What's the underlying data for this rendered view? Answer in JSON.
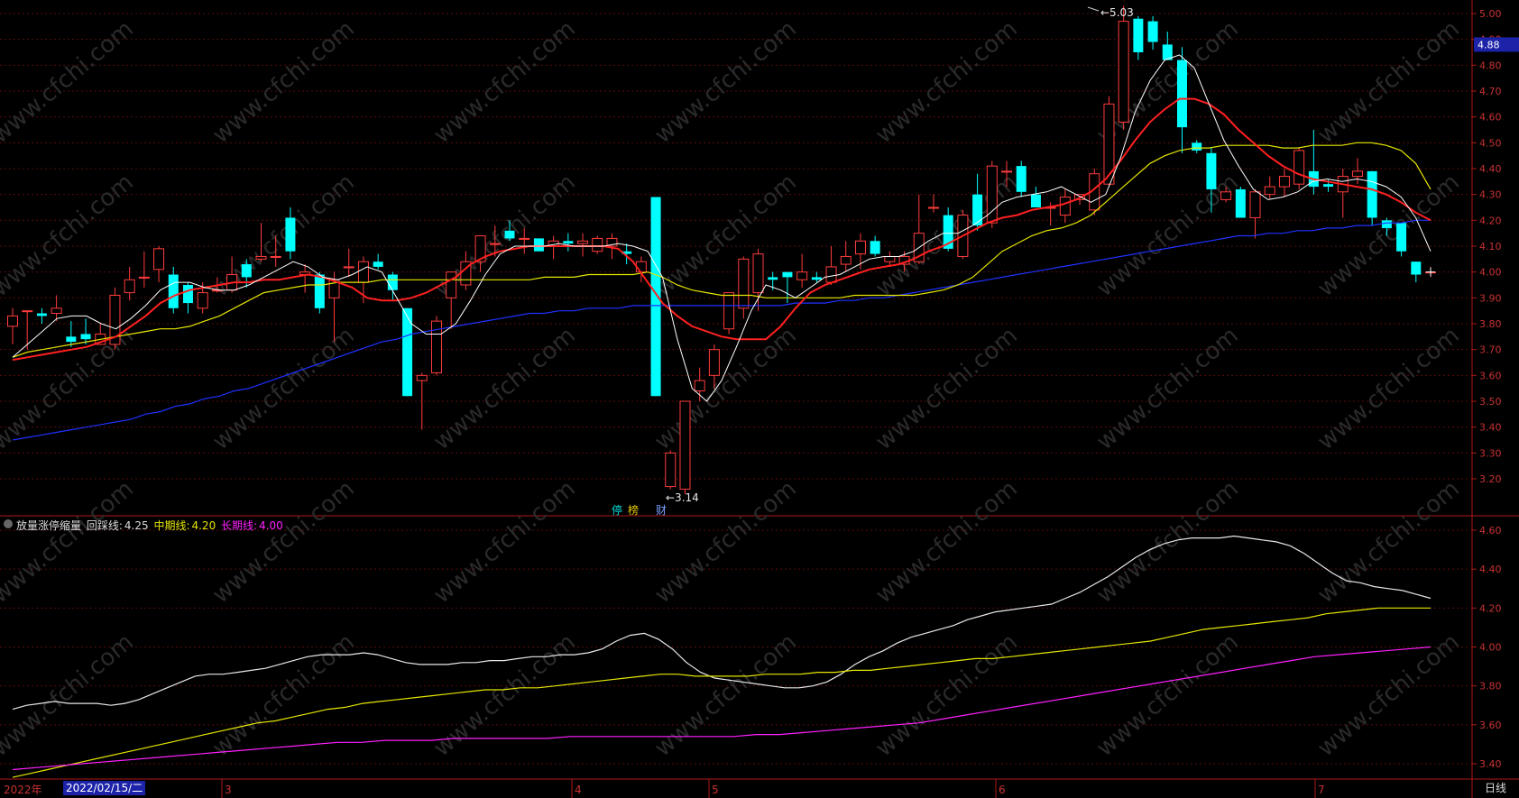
{
  "chart_data": {
    "type": "candlestick",
    "upper_y_ticks": [
      "5.00",
      "4.90",
      "4.80",
      "4.70",
      "4.60",
      "4.50",
      "4.40",
      "4.30",
      "4.20",
      "4.10",
      "4.00",
      "3.90",
      "3.80",
      "3.70",
      "3.60",
      "3.50",
      "3.40",
      "3.30",
      "3.20"
    ],
    "lower_y_ticks": [
      "4.60",
      "4.40",
      "4.20",
      "4.00",
      "3.80",
      "3.60",
      "3.40"
    ],
    "current_price": "4.88",
    "high_label": "5.03",
    "low_label": "3.14",
    "x_labels": [
      "2022年",
      "2022/02/15/二",
      "3",
      "4",
      "5",
      "6",
      "7"
    ],
    "period": "日线",
    "event_markers": [
      "停",
      "榜",
      "财"
    ],
    "watermark": "www.cfchi.com",
    "colors": {
      "up": "#ff3c3c",
      "down": "#00ffff",
      "ma_white": "#ffffff",
      "ma_red": "#ff2020",
      "ma_yellow": "#e6e600",
      "ma_blue": "#1e32ff",
      "ind_white": "#e8e8e8",
      "ind_yellow": "#e6e600",
      "ind_magenta": "#ff20ff",
      "axis": "#b01818"
    },
    "candles": [
      [
        3.79,
        3.83,
        3.72,
        3.86
      ],
      [
        3.85,
        3.85,
        3.7,
        3.85
      ],
      [
        3.84,
        3.83,
        3.8,
        3.86
      ],
      [
        3.84,
        3.86,
        3.81,
        3.91
      ],
      [
        3.75,
        3.73,
        3.71,
        3.81
      ],
      [
        3.76,
        3.74,
        3.72,
        3.82
      ],
      [
        3.72,
        3.76,
        3.72,
        3.8
      ],
      [
        3.72,
        3.91,
        3.7,
        3.94
      ],
      [
        3.92,
        3.97,
        3.89,
        4.02
      ],
      [
        3.98,
        3.98,
        3.94,
        4.08
      ],
      [
        4.01,
        4.09,
        3.96,
        4.1
      ],
      [
        3.99,
        3.86,
        3.84,
        4.02
      ],
      [
        3.95,
        3.88,
        3.84,
        3.96
      ],
      [
        3.86,
        3.92,
        3.84,
        3.96
      ],
      [
        3.93,
        3.93,
        3.92,
        3.98
      ],
      [
        3.93,
        3.99,
        3.92,
        4.06
      ],
      [
        4.03,
        3.98,
        3.94,
        4.05
      ],
      [
        4.05,
        4.06,
        4.04,
        4.19
      ],
      [
        4.06,
        4.06,
        4.02,
        4.14
      ],
      [
        4.21,
        4.08,
        4.05,
        4.25
      ],
      [
        3.99,
        4.0,
        3.92,
        4.03
      ],
      [
        3.99,
        3.86,
        3.84,
        4.0
      ],
      [
        3.9,
        3.97,
        3.73,
        4.0
      ],
      [
        4.02,
        4.02,
        3.98,
        4.09
      ],
      [
        3.96,
        4.04,
        3.88,
        4.06
      ],
      [
        4.04,
        4.02,
        4.01,
        4.07
      ],
      [
        3.99,
        3.93,
        3.89,
        4.0
      ],
      [
        3.86,
        3.52,
        3.52,
        3.86
      ],
      [
        3.58,
        3.6,
        3.39,
        3.61
      ],
      [
        3.61,
        3.81,
        3.6,
        3.83
      ],
      [
        3.9,
        4.0,
        3.78,
        4.0
      ],
      [
        3.95,
        4.04,
        3.93,
        4.08
      ],
      [
        4.04,
        4.14,
        4.0,
        4.14
      ],
      [
        4.11,
        4.11,
        4.06,
        4.18
      ],
      [
        4.16,
        4.13,
        4.12,
        4.2
      ],
      [
        4.13,
        4.13,
        4.07,
        4.17
      ],
      [
        4.13,
        4.08,
        4.08,
        4.13
      ],
      [
        4.1,
        4.12,
        4.05,
        4.14
      ],
      [
        4.12,
        4.11,
        4.08,
        4.15
      ],
      [
        4.11,
        4.12,
        4.06,
        4.15
      ],
      [
        4.08,
        4.13,
        4.07,
        4.14
      ],
      [
        4.1,
        4.13,
        4.05,
        4.15
      ],
      [
        4.08,
        4.07,
        4.03,
        4.11
      ],
      [
        4.0,
        4.04,
        3.96,
        4.06
      ],
      [
        4.29,
        3.52,
        3.52,
        4.29
      ],
      [
        3.17,
        3.3,
        3.16,
        3.31
      ],
      [
        3.16,
        3.5,
        3.14,
        3.5
      ],
      [
        3.54,
        3.58,
        3.5,
        3.63
      ],
      [
        3.6,
        3.7,
        3.55,
        3.72
      ],
      [
        3.78,
        3.92,
        3.76,
        3.92
      ],
      [
        3.86,
        4.05,
        3.82,
        4.06
      ],
      [
        3.92,
        4.07,
        3.85,
        4.09
      ],
      [
        3.98,
        3.97,
        3.93,
        4.0
      ],
      [
        4.0,
        3.98,
        3.88,
        4.0
      ],
      [
        3.97,
        4.0,
        3.94,
        4.07
      ],
      [
        3.98,
        3.97,
        3.96,
        4.0
      ],
      [
        3.96,
        4.02,
        3.95,
        4.1
      ],
      [
        4.03,
        4.06,
        4.0,
        4.12
      ],
      [
        4.07,
        4.12,
        4.01,
        4.15
      ],
      [
        4.12,
        4.07,
        4.06,
        4.14
      ],
      [
        4.04,
        4.06,
        4.02,
        4.08
      ],
      [
        4.03,
        4.06,
        4.0,
        4.08
      ],
      [
        4.04,
        4.15,
        4.03,
        4.3
      ],
      [
        4.25,
        4.25,
        4.23,
        4.3
      ],
      [
        4.22,
        4.09,
        4.08,
        4.25
      ],
      [
        4.06,
        4.22,
        4.05,
        4.24
      ],
      [
        4.3,
        4.18,
        4.16,
        4.38
      ],
      [
        4.19,
        4.41,
        4.17,
        4.43
      ],
      [
        4.39,
        4.39,
        4.33,
        4.43
      ],
      [
        4.41,
        4.31,
        4.29,
        4.43
      ],
      [
        4.3,
        4.25,
        4.25,
        4.33
      ],
      [
        4.25,
        4.25,
        4.18,
        4.27
      ],
      [
        4.22,
        4.29,
        4.19,
        4.32
      ],
      [
        4.28,
        4.3,
        4.26,
        4.3
      ],
      [
        4.24,
        4.38,
        4.22,
        4.4
      ],
      [
        4.34,
        4.65,
        4.33,
        4.68
      ],
      [
        4.58,
        4.97,
        4.55,
        5.03
      ],
      [
        4.98,
        4.85,
        4.82,
        4.99
      ],
      [
        4.97,
        4.89,
        4.86,
        4.99
      ],
      [
        4.88,
        4.82,
        4.82,
        4.93
      ],
      [
        4.82,
        4.56,
        4.46,
        4.87
      ],
      [
        4.5,
        4.47,
        4.46,
        4.51
      ],
      [
        4.46,
        4.32,
        4.23,
        4.48
      ],
      [
        4.28,
        4.31,
        4.27,
        4.33
      ],
      [
        4.32,
        4.21,
        4.21,
        4.33
      ],
      [
        4.21,
        4.31,
        4.13,
        4.32
      ],
      [
        4.3,
        4.33,
        4.28,
        4.37
      ],
      [
        4.33,
        4.37,
        4.29,
        4.4
      ],
      [
        4.34,
        4.47,
        4.32,
        4.48
      ],
      [
        4.39,
        4.33,
        4.3,
        4.55
      ],
      [
        4.34,
        4.33,
        4.31,
        4.36
      ],
      [
        4.31,
        4.37,
        4.21,
        4.4
      ],
      [
        4.37,
        4.39,
        4.34,
        4.44
      ],
      [
        4.39,
        4.21,
        4.18,
        4.39
      ],
      [
        4.2,
        4.17,
        4.14,
        4.21
      ],
      [
        4.19,
        4.08,
        4.06,
        4.19
      ],
      [
        4.04,
        3.99,
        3.96,
        4.04
      ],
      [
        4.0,
        4.0,
        3.98,
        4.02
      ]
    ],
    "ma_white": [
      3.67,
      3.72,
      3.77,
      3.82,
      3.83,
      3.83,
      3.8,
      3.78,
      3.82,
      3.87,
      3.93,
      3.96,
      3.96,
      3.94,
      3.93,
      3.93,
      3.95,
      3.98,
      4.01,
      4.04,
      4.02,
      3.98,
      3.97,
      3.99,
      4.02,
      4.0,
      3.9,
      3.8,
      3.76,
      3.76,
      3.8,
      3.89,
      3.99,
      4.07,
      4.1,
      4.1,
      4.1,
      4.11,
      4.1,
      4.1,
      4.1,
      4.11,
      4.1,
      4.08,
      3.98,
      3.74,
      3.55,
      3.5,
      3.58,
      3.71,
      3.85,
      3.95,
      3.93,
      3.9,
      3.94,
      3.98,
      3.99,
      4.02,
      4.05,
      4.06,
      4.06,
      4.08,
      4.12,
      4.15,
      4.15,
      4.18,
      4.22,
      4.27,
      4.29,
      4.3,
      4.31,
      4.33,
      4.3,
      4.27,
      4.3,
      4.44,
      4.62,
      4.74,
      4.82,
      4.84,
      4.79,
      4.65,
      4.51,
      4.41,
      4.32,
      4.28,
      4.29,
      4.31,
      4.35,
      4.36,
      4.35,
      4.36,
      4.35,
      4.33,
      4.29,
      4.21,
      4.08
    ],
    "ma_red": [
      3.66,
      3.67,
      3.68,
      3.69,
      3.7,
      3.71,
      3.73,
      3.75,
      3.79,
      3.83,
      3.88,
      3.91,
      3.93,
      3.94,
      3.95,
      3.96,
      3.96,
      3.97,
      3.97,
      3.98,
      3.99,
      3.98,
      3.96,
      3.94,
      3.9,
      3.89,
      3.89,
      3.9,
      3.92,
      3.95,
      3.98,
      4.03,
      4.06,
      4.08,
      4.09,
      4.1,
      4.1,
      4.1,
      4.1,
      4.1,
      4.1,
      4.09,
      4.04,
      3.96,
      3.88,
      3.83,
      3.79,
      3.77,
      3.75,
      3.74,
      3.74,
      3.74,
      3.79,
      3.86,
      3.92,
      3.95,
      3.97,
      3.99,
      4.01,
      4.02,
      4.03,
      4.05,
      4.08,
      4.1,
      4.13,
      4.16,
      4.19,
      4.21,
      4.22,
      4.24,
      4.25,
      4.26,
      4.28,
      4.31,
      4.36,
      4.43,
      4.51,
      4.58,
      4.63,
      4.67,
      4.67,
      4.65,
      4.61,
      4.55,
      4.5,
      4.45,
      4.41,
      4.38,
      4.36,
      4.35,
      4.34,
      4.33,
      4.32,
      4.3,
      4.27,
      4.23,
      4.2
    ],
    "ma_yellow": [
      3.67,
      3.69,
      3.7,
      3.71,
      3.72,
      3.73,
      3.74,
      3.75,
      3.76,
      3.77,
      3.78,
      3.78,
      3.79,
      3.81,
      3.83,
      3.86,
      3.89,
      3.92,
      3.93,
      3.94,
      3.95,
      3.95,
      3.96,
      3.96,
      3.96,
      3.97,
      3.97,
      3.97,
      3.97,
      3.97,
      3.97,
      3.97,
      3.97,
      3.97,
      3.97,
      3.97,
      3.98,
      3.98,
      3.98,
      3.99,
      3.99,
      3.99,
      3.99,
      4.0,
      3.98,
      3.95,
      3.93,
      3.92,
      3.91,
      3.91,
      3.91,
      3.9,
      3.9,
      3.9,
      3.9,
      3.9,
      3.9,
      3.91,
      3.91,
      3.91,
      3.91,
      3.91,
      3.92,
      3.93,
      3.95,
      3.98,
      4.03,
      4.08,
      4.11,
      4.14,
      4.16,
      4.17,
      4.19,
      4.22,
      4.27,
      4.32,
      4.37,
      4.42,
      4.45,
      4.47,
      4.48,
      4.48,
      4.49,
      4.49,
      4.49,
      4.49,
      4.48,
      4.48,
      4.49,
      4.49,
      4.49,
      4.5,
      4.5,
      4.49,
      4.47,
      4.42,
      4.32
    ],
    "ma_blue": [
      3.35,
      3.36,
      3.37,
      3.38,
      3.39,
      3.4,
      3.41,
      3.42,
      3.43,
      3.45,
      3.46,
      3.48,
      3.49,
      3.51,
      3.52,
      3.54,
      3.55,
      3.57,
      3.59,
      3.61,
      3.63,
      3.65,
      3.67,
      3.69,
      3.71,
      3.73,
      3.74,
      3.76,
      3.77,
      3.78,
      3.79,
      3.8,
      3.81,
      3.82,
      3.83,
      3.84,
      3.84,
      3.85,
      3.85,
      3.86,
      3.86,
      3.86,
      3.87,
      3.87,
      3.87,
      3.87,
      3.87,
      3.87,
      3.87,
      3.87,
      3.87,
      3.87,
      3.87,
      3.88,
      3.88,
      3.88,
      3.89,
      3.89,
      3.9,
      3.9,
      3.91,
      3.92,
      3.93,
      3.94,
      3.95,
      3.96,
      3.97,
      3.98,
      3.99,
      4.0,
      4.01,
      4.02,
      4.03,
      4.04,
      4.05,
      4.06,
      4.07,
      4.08,
      4.09,
      4.1,
      4.11,
      4.12,
      4.13,
      4.14,
      4.14,
      4.15,
      4.15,
      4.16,
      4.16,
      4.17,
      4.17,
      4.18,
      4.18,
      4.19,
      4.19,
      4.2,
      4.2
    ],
    "indicator": {
      "name": "放量涨停缩量",
      "lines": [
        {
          "label": "回踩线:",
          "value": "4.25",
          "color": "#e8e8e8"
        },
        {
          "label": "中期线:",
          "value": "4.20",
          "color": "#e6e600"
        },
        {
          "label": "长期线:",
          "value": "4.00",
          "color": "#ff20ff"
        }
      ],
      "white": [
        3.68,
        3.7,
        3.71,
        3.72,
        3.71,
        3.71,
        3.71,
        3.7,
        3.71,
        3.73,
        3.76,
        3.79,
        3.82,
        3.85,
        3.86,
        3.86,
        3.87,
        3.88,
        3.89,
        3.91,
        3.93,
        3.95,
        3.96,
        3.96,
        3.96,
        3.97,
        3.96,
        3.94,
        3.92,
        3.91,
        3.91,
        3.91,
        3.92,
        3.92,
        3.93,
        3.93,
        3.94,
        3.95,
        3.95,
        3.96,
        3.96,
        3.97,
        3.99,
        4.03,
        4.06,
        4.07,
        4.04,
        3.99,
        3.92,
        3.87,
        3.84,
        3.83,
        3.82,
        3.81,
        3.8,
        3.79,
        3.79,
        3.8,
        3.82,
        3.86,
        3.91,
        3.95,
        3.98,
        4.02,
        4.05,
        4.07,
        4.09,
        4.11,
        4.14,
        4.16,
        4.18,
        4.19,
        4.2,
        4.21,
        4.22,
        4.25,
        4.28,
        4.32,
        4.36,
        4.41,
        4.46,
        4.5,
        4.53,
        4.55,
        4.56,
        4.56,
        4.56,
        4.57,
        4.56,
        4.55,
        4.54,
        4.52,
        4.48,
        4.43,
        4.38,
        4.34,
        4.33,
        4.31,
        4.3,
        4.29,
        4.27,
        4.25
      ],
      "yellow": [
        3.33,
        3.35,
        3.37,
        3.39,
        3.41,
        3.43,
        3.45,
        3.47,
        3.49,
        3.51,
        3.53,
        3.55,
        3.57,
        3.59,
        3.61,
        3.62,
        3.64,
        3.66,
        3.68,
        3.69,
        3.71,
        3.72,
        3.73,
        3.74,
        3.75,
        3.76,
        3.77,
        3.78,
        3.78,
        3.79,
        3.79,
        3.8,
        3.81,
        3.82,
        3.83,
        3.84,
        3.85,
        3.86,
        3.86,
        3.85,
        3.85,
        3.85,
        3.85,
        3.86,
        3.86,
        3.86,
        3.87,
        3.87,
        3.88,
        3.88,
        3.89,
        3.9,
        3.91,
        3.92,
        3.93,
        3.94,
        3.94,
        3.95,
        3.96,
        3.97,
        3.98,
        3.99,
        4.0,
        4.01,
        4.02,
        4.03,
        4.05,
        4.07,
        4.09,
        4.1,
        4.11,
        4.12,
        4.13,
        4.14,
        4.15,
        4.17,
        4.18,
        4.19,
        4.2,
        4.2,
        4.2,
        4.2
      ],
      "magenta": [
        3.37,
        3.38,
        3.39,
        3.4,
        3.41,
        3.42,
        3.43,
        3.44,
        3.45,
        3.46,
        3.47,
        3.48,
        3.49,
        3.5,
        3.51,
        3.51,
        3.52,
        3.52,
        3.52,
        3.53,
        3.53,
        3.53,
        3.53,
        3.53,
        3.54,
        3.54,
        3.54,
        3.54,
        3.54,
        3.54,
        3.54,
        3.54,
        3.55,
        3.55,
        3.56,
        3.57,
        3.58,
        3.59,
        3.6,
        3.61,
        3.63,
        3.65,
        3.67,
        3.69,
        3.71,
        3.73,
        3.75,
        3.77,
        3.79,
        3.81,
        3.83,
        3.85,
        3.87,
        3.89,
        3.91,
        3.93,
        3.95,
        3.96,
        3.97,
        3.98,
        3.99,
        4.0
      ]
    }
  }
}
